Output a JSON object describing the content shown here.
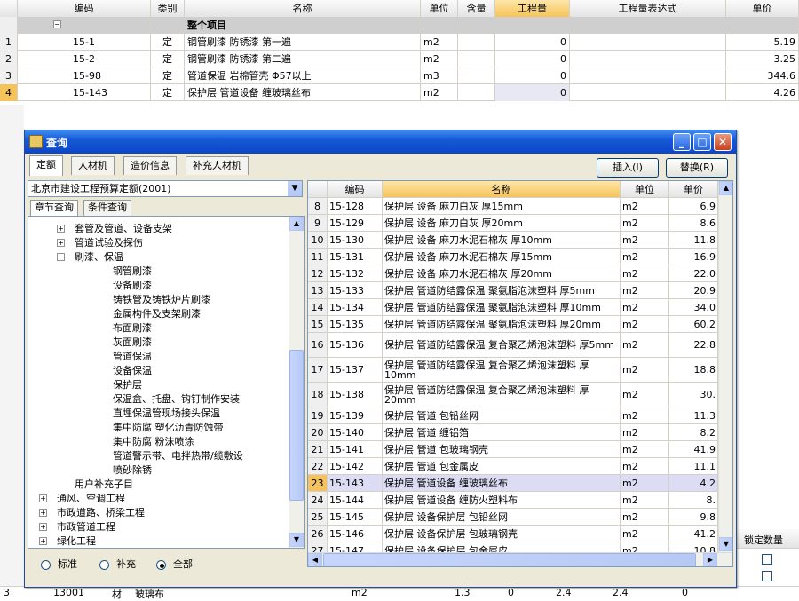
{
  "main_grid": {
    "headers": [
      "",
      "编码",
      "类别",
      "名称",
      "单位",
      "含量",
      "工程量",
      "工程量表达式",
      "单价"
    ],
    "project_row": {
      "expand": "−",
      "label": "整个项目"
    },
    "rows": [
      {
        "num": "1",
        "code": "15-1",
        "type": "定",
        "name": "钢管刷漆 防锈漆 第一遍",
        "unit": "m2",
        "qty": "0",
        "price": "5.19"
      },
      {
        "num": "2",
        "code": "15-2",
        "type": "定",
        "name": "钢管刷漆 防锈漆 第二遍",
        "unit": "m2",
        "qty": "0",
        "price": "3.25"
      },
      {
        "num": "3",
        "code": "15-98",
        "type": "定",
        "name": "管道保温 岩棉管壳 Φ57以上",
        "unit": "m3",
        "qty": "0",
        "price": "344.6"
      },
      {
        "num": "4",
        "code": "15-143",
        "type": "定",
        "name": "保护层 管道设备 缠玻璃丝布",
        "unit": "m2",
        "qty": "0",
        "price": "4.26"
      }
    ]
  },
  "dialog": {
    "title": "查询",
    "tabs": [
      "定额",
      "人材机",
      "造价信息",
      "补充人材机"
    ],
    "insert_label": "插入(I)",
    "replace_label": "替换(R)",
    "quota_library": "北京市建设工程预算定额(2001)",
    "subtabs": [
      "章节查询",
      "条件查询"
    ],
    "tree": [
      {
        "label": "套管及管道、设备支架",
        "level": 1,
        "exp": "+"
      },
      {
        "label": "管道试验及探伤",
        "level": 1,
        "exp": "+"
      },
      {
        "label": "刷漆、保温",
        "level": 1,
        "exp": "−"
      },
      {
        "label": "钢管刷漆",
        "level": 2
      },
      {
        "label": "设备刷漆",
        "level": 2
      },
      {
        "label": "铸铁管及铸铁炉片刷漆",
        "level": 2
      },
      {
        "label": "金属构件及支架刷漆",
        "level": 2
      },
      {
        "label": "布面刷漆",
        "level": 2
      },
      {
        "label": "灰面刷漆",
        "level": 2
      },
      {
        "label": "管道保温",
        "level": 2
      },
      {
        "label": "设备保温",
        "level": 2
      },
      {
        "label": "保护层",
        "level": 2
      },
      {
        "label": "保温盒、托盘、钩钉制作安装",
        "level": 2
      },
      {
        "label": "直埋保温管现场接头保温",
        "level": 2
      },
      {
        "label": "集中防腐 塑化沥青防蚀带",
        "level": 2
      },
      {
        "label": "集中防腐 粉沫喷涂",
        "level": 2
      },
      {
        "label": "管道警示带、电拌热带/缆敷设",
        "level": 2
      },
      {
        "label": "喷砂除锈",
        "level": 2
      },
      {
        "label": "用户补充子目",
        "level": 1
      },
      {
        "label": "通风、空调工程",
        "level": 0,
        "exp": "+"
      },
      {
        "label": "市政道路、桥梁工程",
        "level": 0,
        "exp": "+"
      },
      {
        "label": "市政管道工程",
        "level": 0,
        "exp": "+"
      },
      {
        "label": "绿化工程",
        "level": 0,
        "exp": "+"
      }
    ],
    "radios": [
      {
        "label": "标准",
        "checked": false
      },
      {
        "label": "补充",
        "checked": false
      },
      {
        "label": "全部",
        "checked": true
      }
    ],
    "grid_headers": [
      "",
      "编码",
      "名称",
      "单位",
      "单价"
    ],
    "grid_rows": [
      {
        "num": "8",
        "code": "15-128",
        "name": "保护层 设备 麻刀白灰 厚15mm",
        "unit": "m2",
        "price": "6.9"
      },
      {
        "num": "9",
        "code": "15-129",
        "name": "保护层 设备 麻刀白灰 厚20mm",
        "unit": "m2",
        "price": "8.6"
      },
      {
        "num": "10",
        "code": "15-130",
        "name": "保护层 设备 麻刀水泥石棉灰 厚10mm",
        "unit": "m2",
        "price": "11.8"
      },
      {
        "num": "11",
        "code": "15-131",
        "name": "保护层 设备 麻刀水泥石棉灰 厚15mm",
        "unit": "m2",
        "price": "16.9"
      },
      {
        "num": "12",
        "code": "15-132",
        "name": "保护层 设备 麻刀水泥石棉灰 厚20mm",
        "unit": "m2",
        "price": "22.0"
      },
      {
        "num": "13",
        "code": "15-133",
        "name": "保护层 管道防结露保温 聚氨脂泡沫塑料 厚5mm",
        "unit": "m2",
        "price": "20.9"
      },
      {
        "num": "14",
        "code": "15-134",
        "name": "保护层 管道防结露保温 聚氨脂泡沫塑料 厚10mm",
        "unit": "m2",
        "price": "34.0"
      },
      {
        "num": "15",
        "code": "15-135",
        "name": "保护层 管道防结露保温 聚氨脂泡沫塑料 厚20mm",
        "unit": "m2",
        "price": "60.2"
      },
      {
        "num": "16",
        "code": "15-136",
        "name": "保护层 管道防结露保温 复合聚乙烯泡沫塑料 厚5mm",
        "unit": "m2",
        "price": "22.8",
        "tall": true
      },
      {
        "num": "17",
        "code": "15-137",
        "name": "保护层 管道防结露保温 复合聚乙烯泡沫塑料 厚10mm",
        "unit": "m2",
        "price": "18.8",
        "tall": true
      },
      {
        "num": "18",
        "code": "15-138",
        "name": "保护层 管道防结露保温 复合聚乙烯泡沫塑料 厚20mm",
        "unit": "m2",
        "price": "30.",
        "tall": true
      },
      {
        "num": "19",
        "code": "15-139",
        "name": "保护层 管道 包铅丝网",
        "unit": "m2",
        "price": "11.3"
      },
      {
        "num": "20",
        "code": "15-140",
        "name": "保护层 管道 缠铝箔",
        "unit": "m2",
        "price": "8.2"
      },
      {
        "num": "21",
        "code": "15-141",
        "name": "保护层 管道 包玻璃钢壳",
        "unit": "m2",
        "price": "41.9"
      },
      {
        "num": "22",
        "code": "15-142",
        "name": "保护层 管道 包金属皮",
        "unit": "m2",
        "price": "11.1"
      },
      {
        "num": "23",
        "code": "15-143",
        "name": "保护层 管道设备 缠玻璃丝布",
        "unit": "m2",
        "price": "4.2",
        "highlight": true
      },
      {
        "num": "24",
        "code": "15-144",
        "name": "保护层 管道设备 缠防火塑料布",
        "unit": "m2",
        "price": "8."
      },
      {
        "num": "25",
        "code": "15-145",
        "name": "保护层 设备保护层 包铅丝网",
        "unit": "m2",
        "price": "9.8"
      },
      {
        "num": "26",
        "code": "15-146",
        "name": "保护层 设备保护层 包玻璃钢壳",
        "unit": "m2",
        "price": "41.2"
      },
      {
        "num": "27",
        "code": "15-147",
        "name": "保护层 设备保护层 包金属皮",
        "unit": "m2",
        "price": "10.8"
      }
    ]
  },
  "bottom": {
    "locked_qty_header": "锁定数量",
    "row": {
      "num": "3",
      "code": "13001",
      "type": "材",
      "name": "玻璃布",
      "unit": "m2",
      "v1": "1.3",
      "v2": "0",
      "v3": "2.4",
      "v4": "2.4",
      "v5": "0"
    }
  }
}
